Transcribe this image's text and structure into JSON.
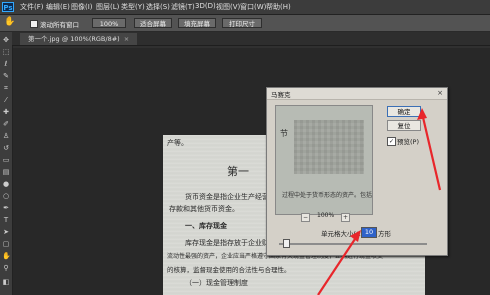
{
  "app": {
    "logo": "Ps"
  },
  "menu": [
    "文件(F)",
    "编辑(E)",
    "图像(I)",
    "图层(L)",
    "类型(Y)",
    "选择(S)",
    "滤镜(T)",
    "3D(D)",
    "视图(V)",
    "窗口(W)",
    "帮助(H)"
  ],
  "options": {
    "scroll_all_label": "滚动所有窗口",
    "buttons": [
      "100%",
      "适合屏幕",
      "填充屏幕",
      "打印尺寸"
    ]
  },
  "document_tab": {
    "title": "第一个.jpg @ 100%(RGB/8#)",
    "close": "×"
  },
  "document_text": {
    "line1": "产等。",
    "title": "第一",
    "line2": "货币资金是指企业生产经营",
    "line3": "存款和其他货币资金。",
    "line4": "一、库存现金",
    "line5": "库存现金是指存放于企业财",
    "line6": "流动性最强的资产，企业应当严格遵守国家有关现金管理制度，正确进行现金收支",
    "line7": "的核算，监督现金使用的合法性与合理性。",
    "line8": "（一）现金管理制度"
  },
  "dialog": {
    "title": "马赛克",
    "close": "×",
    "preview_text_top": "节",
    "preview_text_bottom": "过程中处于货币形态的资产。包括",
    "zoom_minus": "−",
    "zoom_plus": "+",
    "zoom_level": "100%",
    "ok": "确定",
    "reset": "复位",
    "preview_checked": "✓",
    "preview_label": "预览(P)",
    "cell_size_label": "单元格大小(C):",
    "cell_size_value": "10",
    "cell_size_unit": "方形"
  },
  "colors": {
    "arrow": "#e8262b",
    "accent": "#2f62c9"
  }
}
